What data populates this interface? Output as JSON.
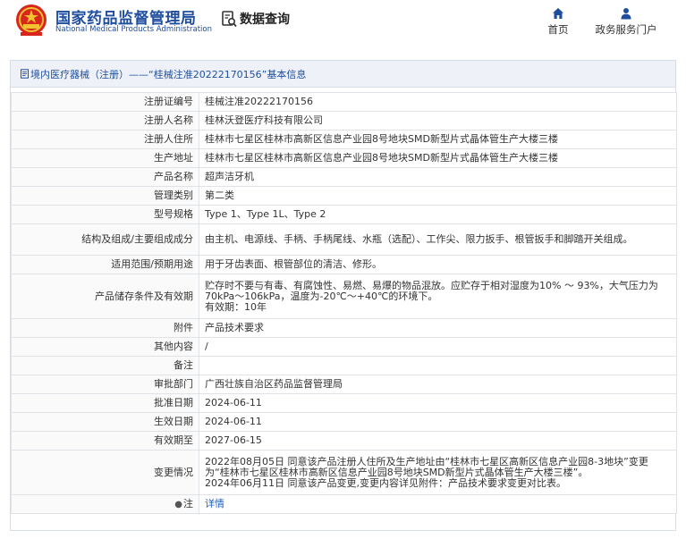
{
  "header": {
    "logo_cn": "国家药品监督管理局",
    "logo_en": "National Medical Products Administration",
    "data_query": "数据查询",
    "nav": [
      {
        "label": "首页",
        "icon": "home-icon"
      },
      {
        "label": "政务服务门户",
        "icon": "user-icon"
      }
    ]
  },
  "panel": {
    "title": "境内医疗器械（注册）——“桂械注准20222170156”基本信息"
  },
  "rows": [
    {
      "label": "注册证编号",
      "value": "桂械注准20222170156"
    },
    {
      "label": "注册人名称",
      "value": "桂林沃登医疗科技有限公司"
    },
    {
      "label": "注册人住所",
      "value": "桂林市七星区桂林市高新区信息产业园8号地块SMD新型片式晶体管生产大楼三楼"
    },
    {
      "label": "生产地址",
      "value": "桂林市七星区桂林市高新区信息产业园8号地块SMD新型片式晶体管生产大楼三楼"
    },
    {
      "label": "产品名称",
      "value": "超声洁牙机"
    },
    {
      "label": "管理类别",
      "value": "第二类"
    },
    {
      "label": "型号规格",
      "value": "Type 1、Type 1L、Type 2"
    },
    {
      "label": "结构及组成/主要组成成分",
      "value": "由主机、电源线、手柄、手柄尾线、水瓶（选配）、工作尖、限力扳手、根管扳手和脚踏开关组成。"
    },
    {
      "label": "适用范围/预期用途",
      "value": "用于牙齿表面、根管部位的清洁、修形。"
    },
    {
      "label": "产品储存条件及有效期",
      "value": "贮存时不要与有毒、有腐蚀性、易燃、易爆的物品混放。应贮存于相对湿度为10% ～ 93%，大气压力为70kPa～106kPa，温度为-20℃～+40℃的环境下。\n有效期：10年"
    },
    {
      "label": "附件",
      "value": "产品技术要求"
    },
    {
      "label": "其他内容",
      "value": "/"
    },
    {
      "label": "备注",
      "value": ""
    },
    {
      "label": "审批部门",
      "value": "广西壮族自治区药品监督管理局"
    },
    {
      "label": "批准日期",
      "value": "2024-06-11"
    },
    {
      "label": "生效日期",
      "value": "2024-06-11"
    },
    {
      "label": "有效期至",
      "value": "2027-06-15"
    },
    {
      "label": "变更情况",
      "value": "2022年08月05日 同意该产品注册人住所及生产地址由“桂林市七星区高新区信息产业园8-3地块”变更为“桂林市七星区桂林市高新区信息产业园8号地块SMD新型片式晶体管生产大楼三楼”。\n2024年06月11日 同意该产品变更,变更内容详见附件：产品技术要求变更对比表。"
    }
  ],
  "note_row": {
    "label": "注",
    "link": "详情"
  }
}
